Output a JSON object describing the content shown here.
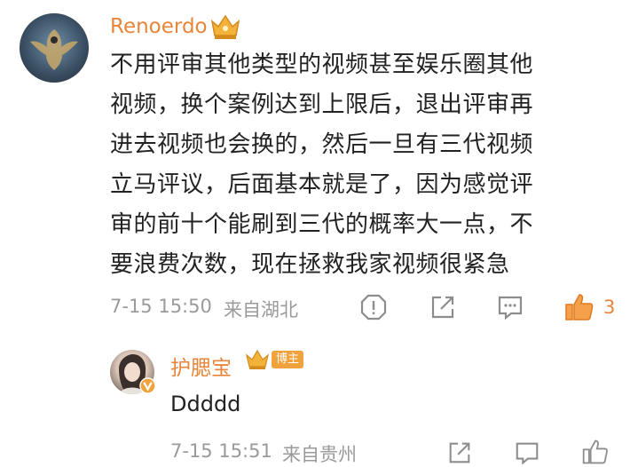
{
  "comment": {
    "author": "Renoerdo",
    "text_lines": [
      "不用评审其他类型的视频甚至娱乐圈其他",
      "视频，换个案例达到上限后，退出评审再",
      "进去视频也会换的，然后一旦有三代视频",
      "立马评议，后面基本就是了，因为感觉评",
      "审的前十个能刷到三代的概率大一点，不",
      "要浪费次数，现在拯救我家视频很紧急"
    ],
    "timestamp": "7-15 15:50",
    "location": "来自湖北",
    "like_count": "3",
    "accent_color": "#e8853a"
  },
  "reply": {
    "author": "护腮宝",
    "badge": "博主",
    "text": "Ddddd",
    "timestamp": "7-15 15:51",
    "location": "来自贵州"
  },
  "icons": {
    "report": "report-icon",
    "share": "share-icon",
    "reply": "comment-icon",
    "like": "like-icon",
    "crown": "crown-icon",
    "verified": "verified-icon"
  }
}
